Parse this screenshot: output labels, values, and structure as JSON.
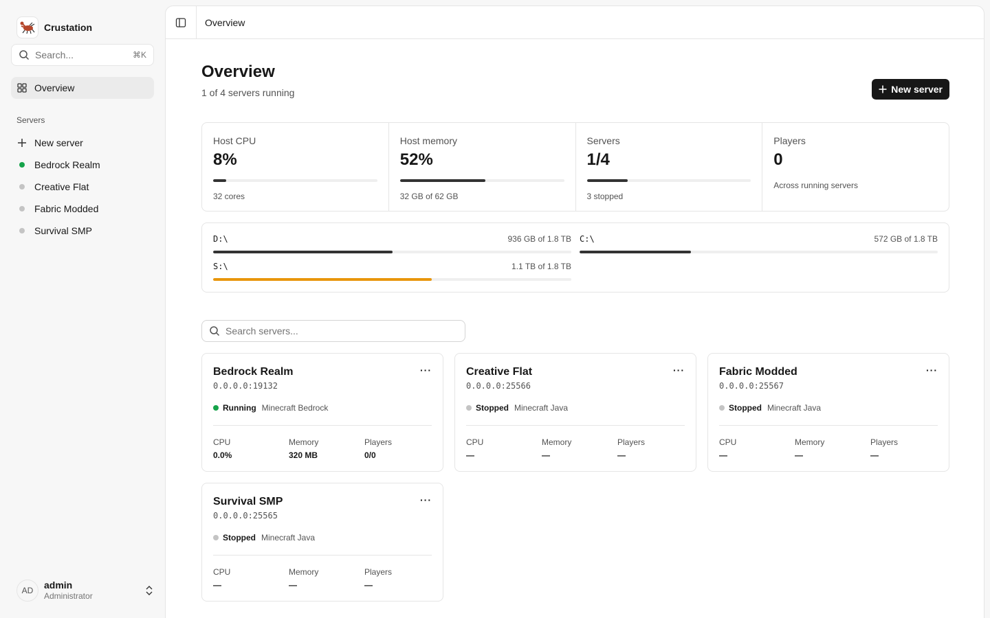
{
  "app": {
    "name": "Crustation"
  },
  "sidebar": {
    "search_placeholder": "Search...",
    "search_shortcut": "⌘K",
    "overview_label": "Overview",
    "section_label": "Servers",
    "new_server_label": "New server",
    "servers": [
      {
        "name": "Bedrock Realm",
        "status_color": "#16a34a"
      },
      {
        "name": "Creative Flat",
        "status_color": "#c4c4c4"
      },
      {
        "name": "Fabric Modded",
        "status_color": "#c4c4c4"
      },
      {
        "name": "Survival SMP",
        "status_color": "#c4c4c4"
      }
    ],
    "user": {
      "initials": "AD",
      "name": "admin",
      "role": "Administrator"
    }
  },
  "topbar": {
    "breadcrumb": "Overview"
  },
  "page": {
    "title": "Overview",
    "subtitle": "1 of 4 servers running",
    "new_server_button": "New server"
  },
  "stats": [
    {
      "label": "Host CPU",
      "value": "8%",
      "sub": "32 cores",
      "progress": 0.08
    },
    {
      "label": "Host memory",
      "value": "52%",
      "sub": "32 GB of 62 GB",
      "progress": 0.52
    },
    {
      "label": "Servers",
      "value": "1/4",
      "sub": "3 stopped",
      "progress": 0.25
    },
    {
      "label": "Players",
      "value": "0",
      "sub": "Across running servers"
    }
  ],
  "disks": [
    {
      "name": "D:\\",
      "usage": "936 GB of 1.8 TB",
      "progress": 0.5,
      "color": "#333333"
    },
    {
      "name": "C:\\",
      "usage": "572 GB of 1.8 TB",
      "progress": 0.31,
      "color": "#333333"
    },
    {
      "name": "S:\\",
      "usage": "1.1 TB of 1.8 TB",
      "progress": 0.61,
      "color": "#e8960c"
    }
  ],
  "server_search_placeholder": "Search servers...",
  "metric_labels": {
    "cpu": "CPU",
    "memory": "Memory",
    "players": "Players"
  },
  "cards": [
    {
      "name": "Bedrock Realm",
      "address": "0.0.0.0:19132",
      "status": "Running",
      "status_color": "#16a34a",
      "edition": "Minecraft Bedrock",
      "cpu": "0.0%",
      "memory": "320 MB",
      "players": "0/0"
    },
    {
      "name": "Creative Flat",
      "address": "0.0.0.0:25566",
      "status": "Stopped",
      "status_color": "#c4c4c4",
      "edition": "Minecraft Java",
      "cpu": "—",
      "memory": "—",
      "players": "—"
    },
    {
      "name": "Fabric Modded",
      "address": "0.0.0.0:25567",
      "status": "Stopped",
      "status_color": "#c4c4c4",
      "edition": "Minecraft Java",
      "cpu": "—",
      "memory": "—",
      "players": "—"
    },
    {
      "name": "Survival SMP",
      "address": "0.0.0.0:25565",
      "status": "Stopped",
      "status_color": "#c4c4c4",
      "edition": "Minecraft Java",
      "cpu": "—",
      "memory": "—",
      "players": "—"
    }
  ],
  "card_menu_label": "···"
}
